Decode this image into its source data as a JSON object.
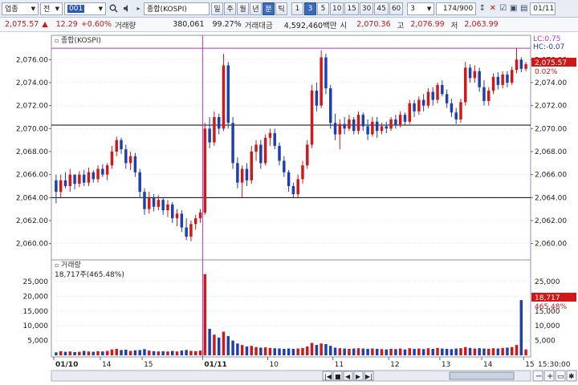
{
  "toolbar": {
    "market": "업종",
    "market_type": "전",
    "code": "001",
    "index_name": "종합(KOSPI)",
    "periods": [
      "일",
      "주",
      "월",
      "년",
      "분",
      "틱"
    ],
    "active_period": "분",
    "minutes": [
      "1",
      "3",
      "5",
      "10",
      "15",
      "30",
      "45",
      "60"
    ],
    "active_minute": "3",
    "combo_value": "3",
    "count": "174/900",
    "date": "01/11"
  },
  "quote": {
    "price": "2,075.57",
    "change": "12.29",
    "change_pct": "+0.60%",
    "volume_label": "거래량",
    "volume": "380,061",
    "volume_ratio": "99.27%",
    "amount_label": "거래대금",
    "amount": "4,592,460백만",
    "open_label": "시",
    "open": "2,070.36",
    "high_label": "고",
    "high": "2,076.99",
    "low_label": "저",
    "low": "2,063.99"
  },
  "price_panel": {
    "title": "종합(KOSPI)",
    "y_ticks": [
      "2,076.00",
      "2,074.00",
      "2,072.00",
      "2,070.00",
      "2,068.00",
      "2,066.00",
      "2,064.00",
      "2,062.00",
      "2,060.00"
    ],
    "right_labels": {
      "lc": "LC:0.75",
      "hc": "HC:-0.07",
      "price": "2,075.57",
      "pct": "0.02%"
    }
  },
  "volume_panel": {
    "title": "거래량",
    "subtitle": "18,717주(465.48%)",
    "y_ticks": [
      "25,000",
      "20,000",
      "15,000",
      "10,000",
      "5,000"
    ],
    "right_labels": {
      "value": "18,717",
      "pct": "465.48%"
    }
  },
  "x_axis": {
    "labels": [
      "01/10",
      "14",
      "15",
      "01/11",
      "10",
      "11",
      "12",
      "13",
      "14",
      "15"
    ],
    "time": "15:30:00"
  },
  "colors": {
    "up": "#d01818",
    "down": "#1f3fb0",
    "hline": "#000000",
    "magenta": "#c030c0"
  },
  "chart_data": {
    "type": "candlestick",
    "price_ylim": [
      2059,
      2077
    ],
    "volume_ylim": [
      0,
      28000
    ],
    "hlines": [
      2070.3,
      2064.0
    ],
    "max_line": 2076.99,
    "session_break_index": 44,
    "candles": [
      {
        "o": 2065.5,
        "h": 2066.0,
        "l": 2063.5,
        "c": 2064.5,
        "v": 1000
      },
      {
        "o": 2064.5,
        "h": 2066.0,
        "l": 2064.0,
        "c": 2065.5,
        "v": 1400
      },
      {
        "o": 2065.5,
        "h": 2066.2,
        "l": 2064.8,
        "c": 2065.0,
        "v": 1200
      },
      {
        "o": 2065.0,
        "h": 2066.5,
        "l": 2064.5,
        "c": 2066.0,
        "v": 1300
      },
      {
        "o": 2066.0,
        "h": 2066.0,
        "l": 2064.7,
        "c": 2065.2,
        "v": 1100
      },
      {
        "o": 2065.2,
        "h": 2066.3,
        "l": 2064.9,
        "c": 2066.0,
        "v": 1200
      },
      {
        "o": 2066.0,
        "h": 2066.4,
        "l": 2065.0,
        "c": 2065.3,
        "v": 1500
      },
      {
        "o": 2065.3,
        "h": 2066.6,
        "l": 2065.0,
        "c": 2066.2,
        "v": 1300
      },
      {
        "o": 2066.2,
        "h": 2066.4,
        "l": 2065.3,
        "c": 2065.6,
        "v": 1200
      },
      {
        "o": 2065.6,
        "h": 2066.8,
        "l": 2065.3,
        "c": 2066.5,
        "v": 1400
      },
      {
        "o": 2066.5,
        "h": 2066.9,
        "l": 2065.8,
        "c": 2066.0,
        "v": 1300
      },
      {
        "o": 2066.0,
        "h": 2067.0,
        "l": 2065.5,
        "c": 2066.8,
        "v": 1500
      },
      {
        "o": 2066.8,
        "h": 2068.5,
        "l": 2066.5,
        "c": 2068.0,
        "v": 2000
      },
      {
        "o": 2068.0,
        "h": 2069.3,
        "l": 2067.6,
        "c": 2069.0,
        "v": 2200
      },
      {
        "o": 2069.0,
        "h": 2069.2,
        "l": 2067.8,
        "c": 2068.2,
        "v": 1800
      },
      {
        "o": 2068.2,
        "h": 2068.6,
        "l": 2066.5,
        "c": 2067.0,
        "v": 1900
      },
      {
        "o": 2067.0,
        "h": 2068.0,
        "l": 2066.4,
        "c": 2067.6,
        "v": 1500
      },
      {
        "o": 2067.6,
        "h": 2067.9,
        "l": 2065.8,
        "c": 2066.2,
        "v": 1700
      },
      {
        "o": 2066.2,
        "h": 2066.5,
        "l": 2064.0,
        "c": 2064.5,
        "v": 1800
      },
      {
        "o": 2064.5,
        "h": 2064.8,
        "l": 2062.5,
        "c": 2063.0,
        "v": 2100
      },
      {
        "o": 2063.0,
        "h": 2064.5,
        "l": 2062.6,
        "c": 2064.0,
        "v": 1600
      },
      {
        "o": 2064.0,
        "h": 2064.3,
        "l": 2062.8,
        "c": 2063.2,
        "v": 1400
      },
      {
        "o": 2063.2,
        "h": 2064.2,
        "l": 2062.9,
        "c": 2063.8,
        "v": 1300
      },
      {
        "o": 2063.8,
        "h": 2064.0,
        "l": 2062.5,
        "c": 2062.9,
        "v": 1400
      },
      {
        "o": 2062.9,
        "h": 2063.8,
        "l": 2062.3,
        "c": 2063.4,
        "v": 1300
      },
      {
        "o": 2063.4,
        "h": 2063.6,
        "l": 2061.8,
        "c": 2062.2,
        "v": 1500
      },
      {
        "o": 2062.2,
        "h": 2063.0,
        "l": 2061.5,
        "c": 2062.6,
        "v": 1300
      },
      {
        "o": 2062.6,
        "h": 2062.9,
        "l": 2061.0,
        "c": 2061.4,
        "v": 1600
      },
      {
        "o": 2061.4,
        "h": 2062.2,
        "l": 2060.3,
        "c": 2060.6,
        "v": 1800
      },
      {
        "o": 2060.6,
        "h": 2062.0,
        "l": 2060.2,
        "c": 2061.7,
        "v": 1500
      },
      {
        "o": 2061.7,
        "h": 2062.5,
        "l": 2061.2,
        "c": 2062.2,
        "v": 1400
      },
      {
        "o": 2062.2,
        "h": 2063.0,
        "l": 2061.8,
        "c": 2062.7,
        "v": 1600
      },
      {
        "o": 2062.7,
        "h": 2070.5,
        "l": 2062.5,
        "c": 2070.0,
        "v": 27500
      },
      {
        "o": 2070.0,
        "h": 2071.0,
        "l": 2068.3,
        "c": 2068.8,
        "v": 9000
      },
      {
        "o": 2068.8,
        "h": 2071.5,
        "l": 2068.5,
        "c": 2071.0,
        "v": 7000
      },
      {
        "o": 2071.0,
        "h": 2071.3,
        "l": 2069.5,
        "c": 2070.0,
        "v": 6000
      },
      {
        "o": 2070.0,
        "h": 2076.5,
        "l": 2069.8,
        "c": 2075.5,
        "v": 8000
      },
      {
        "o": 2075.5,
        "h": 2075.8,
        "l": 2070.0,
        "c": 2070.5,
        "v": 6500
      },
      {
        "o": 2070.5,
        "h": 2071.0,
        "l": 2066.5,
        "c": 2067.0,
        "v": 5000
      },
      {
        "o": 2067.0,
        "h": 2067.5,
        "l": 2064.8,
        "c": 2065.3,
        "v": 4000
      },
      {
        "o": 2065.3,
        "h": 2066.8,
        "l": 2064.0,
        "c": 2066.5,
        "v": 3500
      },
      {
        "o": 2066.5,
        "h": 2067.0,
        "l": 2065.0,
        "c": 2065.5,
        "v": 3000
      },
      {
        "o": 2065.5,
        "h": 2068.5,
        "l": 2065.2,
        "c": 2068.0,
        "v": 3200
      },
      {
        "o": 2068.0,
        "h": 2069.0,
        "l": 2067.2,
        "c": 2068.6,
        "v": 2800
      },
      {
        "o": 2068.6,
        "h": 2069.0,
        "l": 2066.5,
        "c": 2067.0,
        "v": 2600
      },
      {
        "o": 2067.0,
        "h": 2069.5,
        "l": 2066.8,
        "c": 2069.2,
        "v": 2700
      },
      {
        "o": 2069.2,
        "h": 2070.0,
        "l": 2068.5,
        "c": 2069.6,
        "v": 2500
      },
      {
        "o": 2069.6,
        "h": 2070.0,
        "l": 2068.2,
        "c": 2068.5,
        "v": 2400
      },
      {
        "o": 2068.5,
        "h": 2068.8,
        "l": 2066.8,
        "c": 2067.2,
        "v": 2300
      },
      {
        "o": 2067.2,
        "h": 2067.6,
        "l": 2065.8,
        "c": 2066.2,
        "v": 2200
      },
      {
        "o": 2066.2,
        "h": 2066.4,
        "l": 2064.5,
        "c": 2065.0,
        "v": 2300
      },
      {
        "o": 2065.0,
        "h": 2065.3,
        "l": 2064.0,
        "c": 2064.3,
        "v": 2200
      },
      {
        "o": 2064.3,
        "h": 2066.0,
        "l": 2064.0,
        "c": 2065.6,
        "v": 2300
      },
      {
        "o": 2065.6,
        "h": 2067.2,
        "l": 2065.2,
        "c": 2066.8,
        "v": 2500
      },
      {
        "o": 2066.8,
        "h": 2069.0,
        "l": 2066.5,
        "c": 2068.6,
        "v": 3000
      },
      {
        "o": 2068.6,
        "h": 2073.8,
        "l": 2068.3,
        "c": 2073.3,
        "v": 4200
      },
      {
        "o": 2073.3,
        "h": 2074.0,
        "l": 2071.5,
        "c": 2072.0,
        "v": 3500
      },
      {
        "o": 2072.0,
        "h": 2076.8,
        "l": 2071.8,
        "c": 2076.2,
        "v": 4000
      },
      {
        "o": 2076.2,
        "h": 2076.5,
        "l": 2073.0,
        "c": 2073.5,
        "v": 3800
      },
      {
        "o": 2073.5,
        "h": 2073.8,
        "l": 2070.0,
        "c": 2070.5,
        "v": 3200
      },
      {
        "o": 2070.5,
        "h": 2071.3,
        "l": 2069.0,
        "c": 2069.5,
        "v": 2600
      },
      {
        "o": 2069.5,
        "h": 2070.8,
        "l": 2068.2,
        "c": 2070.4,
        "v": 2400
      },
      {
        "o": 2070.4,
        "h": 2071.0,
        "l": 2069.5,
        "c": 2070.0,
        "v": 2300
      },
      {
        "o": 2070.0,
        "h": 2071.2,
        "l": 2069.8,
        "c": 2070.8,
        "v": 2200
      },
      {
        "o": 2070.8,
        "h": 2071.0,
        "l": 2069.5,
        "c": 2069.8,
        "v": 2300
      },
      {
        "o": 2069.8,
        "h": 2071.5,
        "l": 2069.5,
        "c": 2071.2,
        "v": 2400
      },
      {
        "o": 2071.2,
        "h": 2071.4,
        "l": 2069.8,
        "c": 2070.2,
        "v": 2300
      },
      {
        "o": 2070.2,
        "h": 2070.8,
        "l": 2069.0,
        "c": 2069.5,
        "v": 2200
      },
      {
        "o": 2069.5,
        "h": 2071.0,
        "l": 2069.3,
        "c": 2070.6,
        "v": 2300
      },
      {
        "o": 2070.6,
        "h": 2071.0,
        "l": 2069.2,
        "c": 2069.8,
        "v": 2200
      },
      {
        "o": 2069.8,
        "h": 2070.5,
        "l": 2069.5,
        "c": 2070.2,
        "v": 2100
      },
      {
        "o": 2070.2,
        "h": 2070.6,
        "l": 2069.6,
        "c": 2070.0,
        "v": 2000
      },
      {
        "o": 2070.0,
        "h": 2071.0,
        "l": 2069.8,
        "c": 2070.8,
        "v": 2200
      },
      {
        "o": 2070.8,
        "h": 2071.2,
        "l": 2070.0,
        "c": 2070.3,
        "v": 2100
      },
      {
        "o": 2070.3,
        "h": 2071.5,
        "l": 2070.1,
        "c": 2071.2,
        "v": 2300
      },
      {
        "o": 2071.2,
        "h": 2071.4,
        "l": 2070.3,
        "c": 2070.6,
        "v": 2000
      },
      {
        "o": 2070.6,
        "h": 2072.5,
        "l": 2070.4,
        "c": 2072.2,
        "v": 2400
      },
      {
        "o": 2072.2,
        "h": 2072.5,
        "l": 2071.0,
        "c": 2071.5,
        "v": 2200
      },
      {
        "o": 2071.5,
        "h": 2072.8,
        "l": 2071.2,
        "c": 2072.5,
        "v": 2300
      },
      {
        "o": 2072.5,
        "h": 2073.0,
        "l": 2071.5,
        "c": 2072.0,
        "v": 2100
      },
      {
        "o": 2072.0,
        "h": 2073.5,
        "l": 2071.8,
        "c": 2073.2,
        "v": 2400
      },
      {
        "o": 2073.2,
        "h": 2073.6,
        "l": 2072.0,
        "c": 2072.5,
        "v": 2200
      },
      {
        "o": 2072.5,
        "h": 2074.0,
        "l": 2072.2,
        "c": 2073.8,
        "v": 2500
      },
      {
        "o": 2073.8,
        "h": 2074.2,
        "l": 2072.8,
        "c": 2073.0,
        "v": 2300
      },
      {
        "o": 2073.0,
        "h": 2073.4,
        "l": 2071.8,
        "c": 2072.2,
        "v": 2200
      },
      {
        "o": 2072.2,
        "h": 2072.6,
        "l": 2071.0,
        "c": 2071.4,
        "v": 2100
      },
      {
        "o": 2071.4,
        "h": 2071.8,
        "l": 2070.4,
        "c": 2070.8,
        "v": 2300
      },
      {
        "o": 2070.8,
        "h": 2072.6,
        "l": 2070.5,
        "c": 2072.3,
        "v": 2400
      },
      {
        "o": 2072.3,
        "h": 2075.8,
        "l": 2072.0,
        "c": 2075.3,
        "v": 2800
      },
      {
        "o": 2075.3,
        "h": 2075.6,
        "l": 2074.0,
        "c": 2074.4,
        "v": 2500
      },
      {
        "o": 2074.4,
        "h": 2075.5,
        "l": 2074.0,
        "c": 2075.0,
        "v": 2300
      },
      {
        "o": 2075.0,
        "h": 2075.3,
        "l": 2073.2,
        "c": 2073.6,
        "v": 2400
      },
      {
        "o": 2073.6,
        "h": 2074.2,
        "l": 2072.0,
        "c": 2072.4,
        "v": 2300
      },
      {
        "o": 2072.4,
        "h": 2073.6,
        "l": 2072.0,
        "c": 2073.3,
        "v": 2200
      },
      {
        "o": 2073.3,
        "h": 2074.8,
        "l": 2073.0,
        "c": 2074.5,
        "v": 2400
      },
      {
        "o": 2074.5,
        "h": 2074.9,
        "l": 2073.4,
        "c": 2073.8,
        "v": 2300
      },
      {
        "o": 2073.8,
        "h": 2075.0,
        "l": 2073.5,
        "c": 2074.7,
        "v": 2500
      },
      {
        "o": 2074.7,
        "h": 2075.0,
        "l": 2073.6,
        "c": 2074.0,
        "v": 2600
      },
      {
        "o": 2074.0,
        "h": 2075.4,
        "l": 2073.8,
        "c": 2075.1,
        "v": 2800
      },
      {
        "o": 2075.1,
        "h": 2077.0,
        "l": 2074.8,
        "c": 2076.0,
        "v": 3500
      },
      {
        "o": 2076.0,
        "h": 2076.2,
        "l": 2074.9,
        "c": 2075.2,
        "v": 18717
      },
      {
        "o": 2075.2,
        "h": 2075.8,
        "l": 2075.0,
        "c": 2075.6,
        "v": 2000
      }
    ]
  }
}
